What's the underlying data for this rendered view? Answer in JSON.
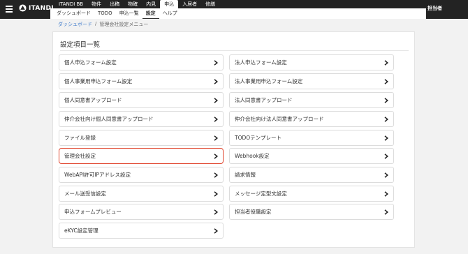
{
  "brand": {
    "name": "ITANDI"
  },
  "nav_primary": [
    {
      "label": "ITANDI BB",
      "active": false
    },
    {
      "label": "物件",
      "active": false
    },
    {
      "label": "出稿",
      "active": false
    },
    {
      "label": "物確",
      "active": false
    },
    {
      "label": "内見",
      "active": false
    },
    {
      "label": "申込",
      "active": true
    },
    {
      "label": "入居者",
      "active": false
    },
    {
      "label": "修繕",
      "active": false
    }
  ],
  "nav_secondary": [
    {
      "label": "ダッシュボード",
      "active": false
    },
    {
      "label": "TODO",
      "active": false
    },
    {
      "label": "申込一覧",
      "active": false
    },
    {
      "label": "設定",
      "active": true
    },
    {
      "label": "ヘルプ",
      "active": false
    }
  ],
  "user": {
    "label": "担当者"
  },
  "breadcrumb": {
    "link": "ダッシュボード",
    "separator": "/",
    "current": "管理会社設定メニュー"
  },
  "page": {
    "title": "設定項目一覧"
  },
  "settings_left": [
    {
      "label": "個人申込フォーム設定"
    },
    {
      "label": "個人事業用申込フォーム設定"
    },
    {
      "label": "個人同意書アップロード"
    },
    {
      "label": "仲介会社向け個人同意書アップロード"
    },
    {
      "label": "ファイル登録"
    },
    {
      "label": "管理会社設定"
    },
    {
      "label": "WebAPI許可IPアドレス設定"
    },
    {
      "label": "メール送受信設定"
    },
    {
      "label": "申込フォームプレビュー"
    },
    {
      "label": "eKYC設定管理"
    }
  ],
  "settings_right": [
    {
      "label": "法人申込フォーム設定"
    },
    {
      "label": "法人事業用申込フォーム設定"
    },
    {
      "label": "法人同意書アップロード"
    },
    {
      "label": "仲介会社向け法人同意書アップロード"
    },
    {
      "label": "TODOテンプレート"
    },
    {
      "label": "Webhook設定"
    },
    {
      "label": "請求情報"
    },
    {
      "label": "メッセージ定型文設定"
    },
    {
      "label": "担当者役職設定"
    }
  ],
  "highlighted_item": "管理会社設定",
  "colors": {
    "topbar": "#232323",
    "highlight": "#e0452e",
    "link": "#3a77c9"
  },
  "icons": {
    "menu": "hamburger-icon",
    "logo": "itandi-logo-icon",
    "item": "chevron-right-icon"
  }
}
